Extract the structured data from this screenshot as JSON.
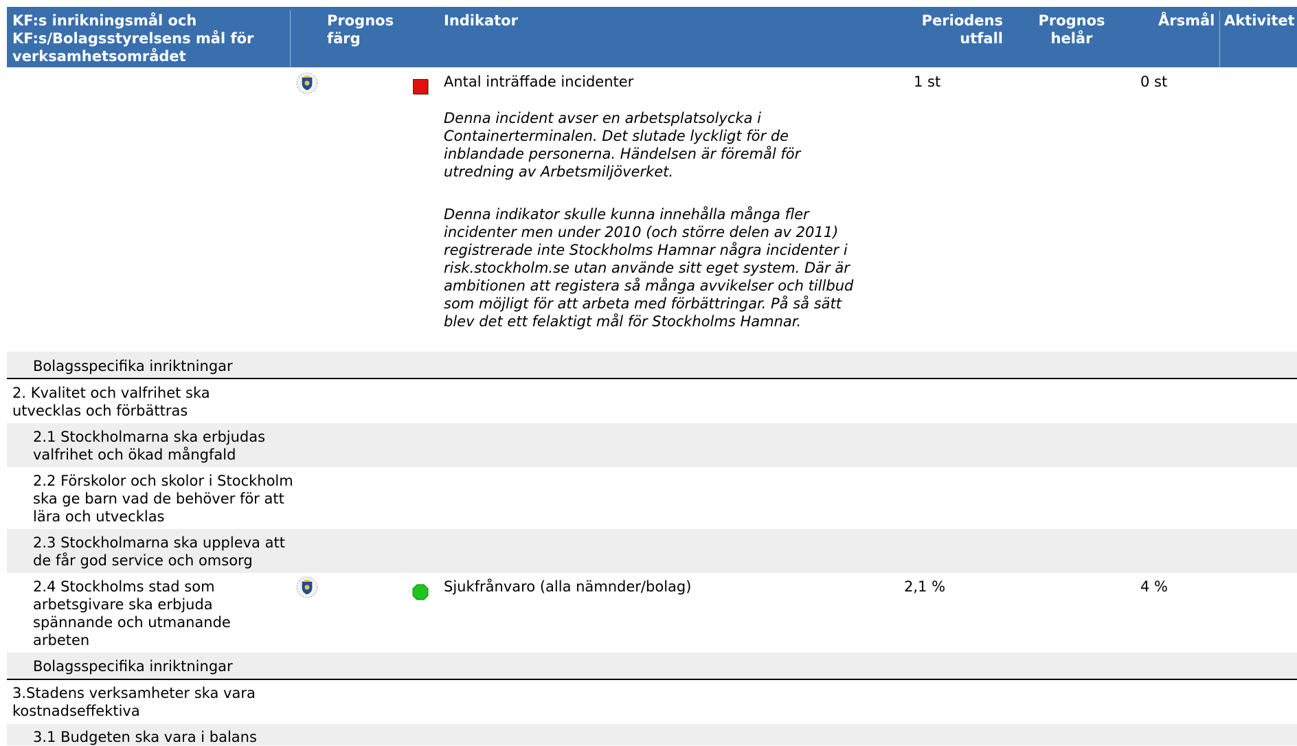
{
  "header": {
    "col_goal": "KF:s inrikningsmål och KF:s/Bolagsstyrelsens mål för verksamhetsområdet",
    "col_prognos_farg_1": "Prognos",
    "col_prognos_farg_2": "färg",
    "col_indikator": "Indikator",
    "col_periodens_1": "Periodens",
    "col_periodens_2": "utfall",
    "col_prognos_helar_1": "Prognos",
    "col_prognos_helar_2": "helår",
    "col_arsmal": "Årsmål",
    "col_aktivitet": "Aktivitet"
  },
  "indicator1": {
    "name": "Antal inträffade incidenter",
    "status": "red",
    "outcome": "1 st",
    "target": "0 st",
    "comment1": "Denna incident avser en arbetsplatsolycka i Containerterminalen. Det slutade lyckligt för de inblandade personerna. Händelsen är föremål för utredning av Arbetsmiljöverket.",
    "comment2": "Denna indikator skulle kunna innehålla många fler incidenter men under 2010 (och större delen av 2011) registrerade inte Stockholms Hamnar några incidenter i risk.stockholm.se utan använde sitt eget system. Där är ambitionen att registera så många avvikelser och tillbud som möjligt för att arbeta med förbättringar. På så sätt blev det ett felaktigt mål för Stockholms Hamnar."
  },
  "rows": {
    "bolag1": "Bolagsspecifika inriktningar",
    "goal2": "2. Kvalitet och valfrihet ska utvecklas och förbättras",
    "goal2_1": "2.1 Stockholmarna ska erbjudas valfrihet och ökad mångfald",
    "goal2_2": "2.2 Förskolor och skolor i Stockholm ska ge barn vad de behöver för att lära och utvecklas",
    "goal2_3": "2.3 Stockholmarna ska uppleva att de får god service och omsorg",
    "goal2_4": "2.4 Stockholms stad som arbetsgivare ska erbjuda spännande och utmanande arbeten",
    "bolag2": "Bolagsspecifika inriktningar",
    "goal3": "3.Stadens verksamheter ska vara kostnadseffektiva",
    "goal3_1": "3.1 Budgeten ska vara i balans"
  },
  "indicator2": {
    "name": "Sjukfrånvaro (alla nämnder/bolag)",
    "status": "green",
    "outcome": "2,1 %",
    "target": "4 %"
  },
  "colors": {
    "header_bg": "#3a6fad",
    "row_grey": "#eeeeee",
    "red": "#e01010",
    "green": "#1fc41f"
  },
  "icons": {
    "city_crest": "stockholm-crest-icon"
  }
}
